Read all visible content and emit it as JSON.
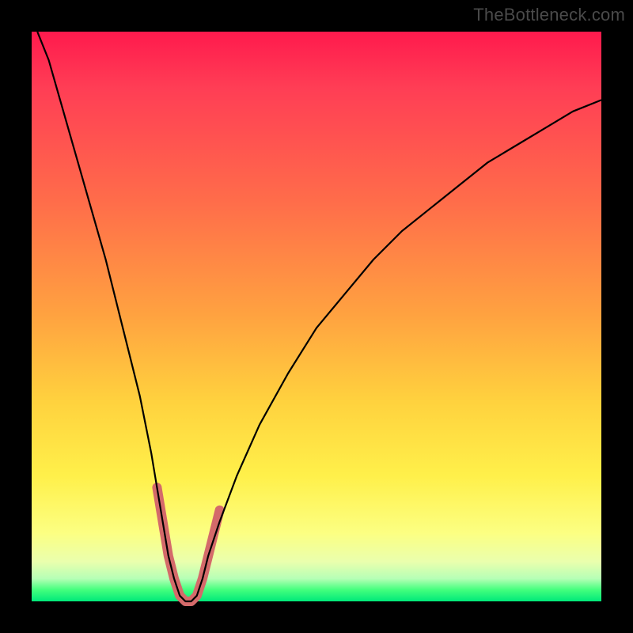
{
  "watermark": "TheBottleneck.com",
  "chart_data": {
    "type": "line",
    "title": "",
    "xlabel": "",
    "ylabel": "",
    "xlim": [
      0,
      100
    ],
    "ylim": [
      0,
      100
    ],
    "grid": false,
    "series": [
      {
        "name": "main-curve",
        "color": "#000000",
        "thickness": 2,
        "x": [
          1,
          3,
          5,
          7,
          9,
          11,
          13,
          15,
          17,
          19,
          21,
          22,
          23,
          24,
          25,
          26,
          27,
          28,
          29,
          30,
          31,
          33,
          36,
          40,
          45,
          50,
          55,
          60,
          65,
          70,
          75,
          80,
          85,
          90,
          95,
          100
        ],
        "y": [
          100,
          95,
          88,
          81,
          74,
          67,
          60,
          52,
          44,
          36,
          26,
          20,
          14,
          8,
          4,
          1,
          0,
          0,
          1,
          4,
          8,
          14,
          22,
          31,
          40,
          48,
          54,
          60,
          65,
          69,
          73,
          77,
          80,
          83,
          86,
          88
        ]
      },
      {
        "name": "highlight-segment",
        "color": "#d46a6a",
        "thickness": 12,
        "linecap": "round",
        "x": [
          22,
          23,
          24,
          25,
          26,
          27,
          28,
          29,
          30,
          31,
          32,
          33
        ],
        "y": [
          20,
          14,
          8,
          4,
          1,
          0,
          0,
          1,
          4,
          8,
          12,
          16
        ]
      }
    ]
  }
}
